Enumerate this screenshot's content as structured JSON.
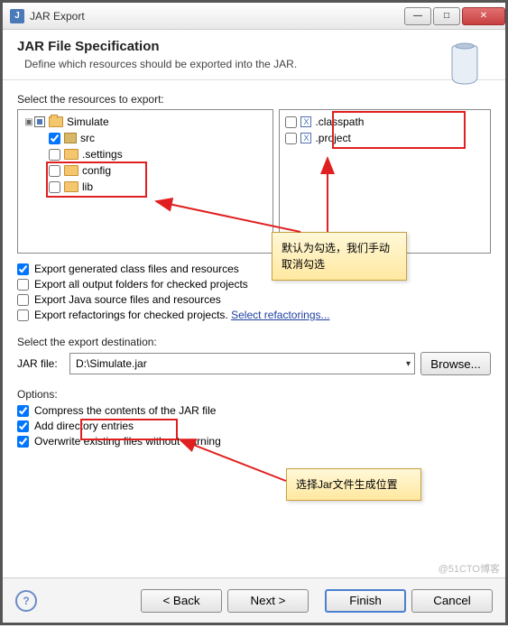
{
  "window": {
    "title": "JAR Export",
    "app_badge": "J"
  },
  "header": {
    "title": "JAR File Specification",
    "subtitle": "Define which resources should be exported into the JAR."
  },
  "resources": {
    "label": "Select the resources to export:",
    "tree": {
      "root": "Simulate",
      "items": [
        "src",
        ".settings",
        "config",
        "lib"
      ]
    },
    "files": [
      ".classpath",
      ".project"
    ]
  },
  "export_options": {
    "generated": "Export generated class files and resources",
    "all_output": "Export all output folders for checked projects",
    "java_source": "Export Java source files and resources",
    "refactorings": "Export refactorings for checked projects.",
    "refactor_link": "Select refactorings..."
  },
  "destination": {
    "label": "Select the export destination:",
    "field_label": "JAR file:",
    "value": "D:\\Simulate.jar",
    "browse": "Browse..."
  },
  "options": {
    "label": "Options:",
    "compress": "Compress the contents of the JAR file",
    "add_dir": "Add directory entries",
    "overwrite": "Overwrite existing files without warning"
  },
  "buttons": {
    "back": "< Back",
    "next": "Next >",
    "finish": "Finish",
    "cancel": "Cancel",
    "help": "?"
  },
  "callouts": {
    "top": "默认为勾选，我们手动取消勾选",
    "bottom": "选择Jar文件生成位置"
  },
  "watermark": "@51CTO博客"
}
